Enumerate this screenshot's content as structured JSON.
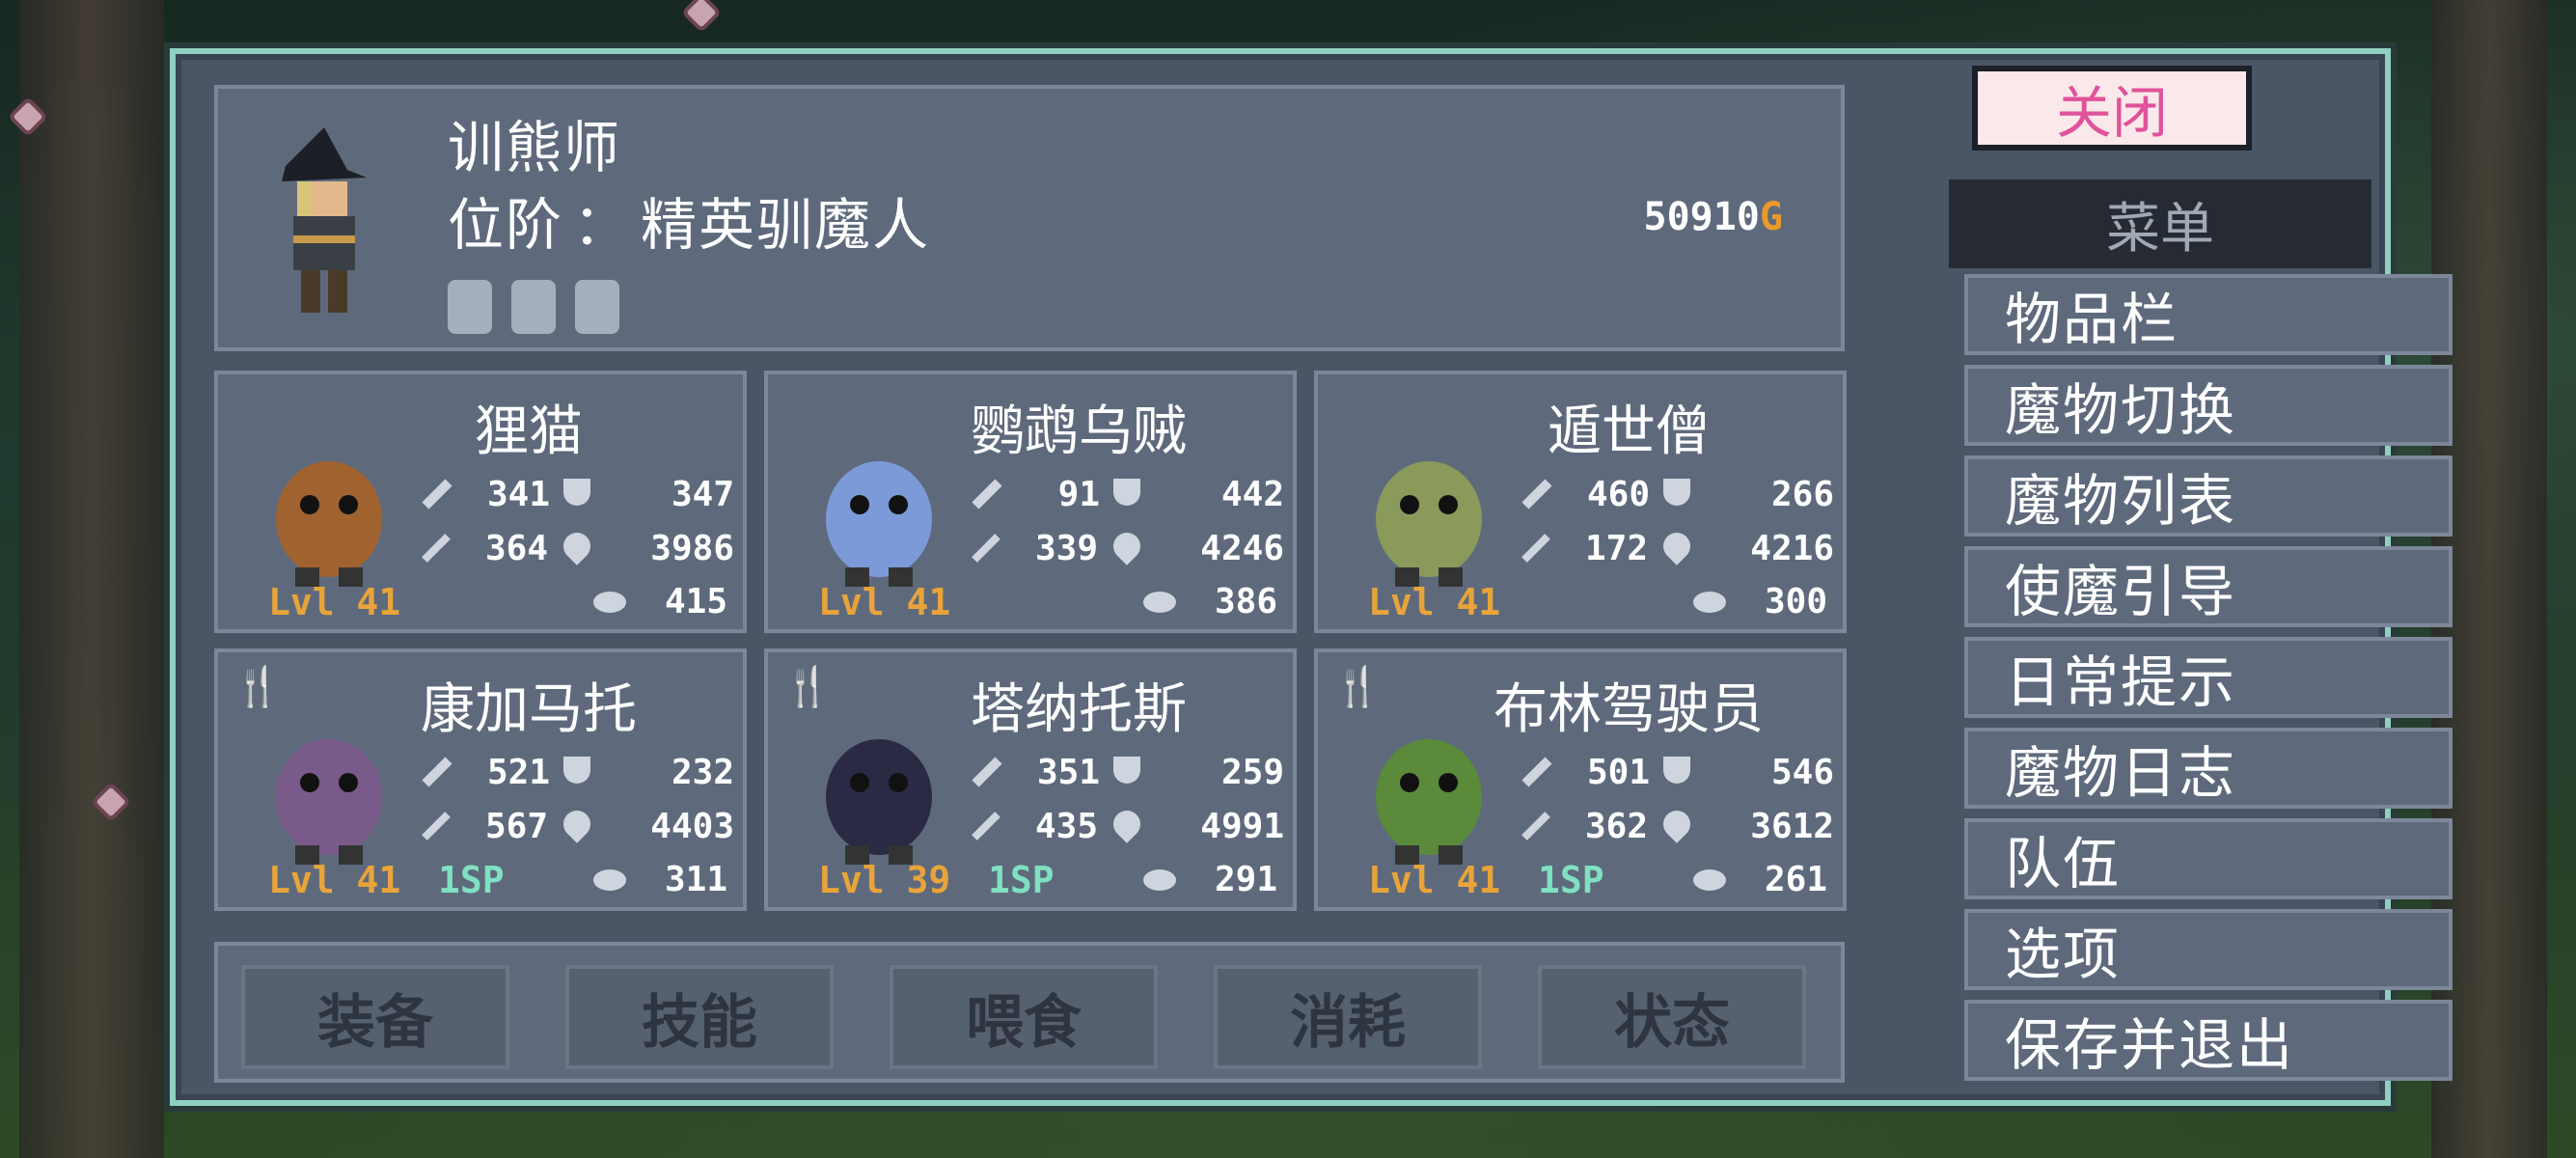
{
  "colors": {
    "frame": "#8fd0c0",
    "panel": "#5e6a7c",
    "level": "#e8a43a",
    "sp": "#7fe0c2",
    "close_text": "#e0529b",
    "gold_g": "#e89a2c"
  },
  "player": {
    "name": "训熊师",
    "rank_label": "位阶",
    "rank_sep": "：",
    "rank": "精英驯魔人",
    "gold": "50910",
    "gold_unit": "G",
    "equipment_icons": [
      "gloves-icon",
      "armor-icon",
      "ring-icon"
    ]
  },
  "monsters": [
    {
      "name": "狸猫",
      "atk": "341",
      "def": "347",
      "mag": "364",
      "hp": "3986",
      "level": "Lvl 41",
      "sp": "",
      "stone": "415",
      "fed": false
    },
    {
      "name": "鹦鹉乌贼",
      "atk": "91",
      "def": "442",
      "mag": "339",
      "hp": "4246",
      "level": "Lvl 41",
      "sp": "",
      "stone": "386",
      "fed": false
    },
    {
      "name": "遁世僧",
      "atk": "460",
      "def": "266",
      "mag": "172",
      "hp": "4216",
      "level": "Lvl 41",
      "sp": "",
      "stone": "300",
      "fed": false
    },
    {
      "name": "康加马托",
      "atk": "521",
      "def": "232",
      "mag": "567",
      "hp": "4403",
      "level": "Lvl 41",
      "sp": "1SP",
      "stone": "311",
      "fed": true
    },
    {
      "name": "塔纳托斯",
      "atk": "351",
      "def": "259",
      "mag": "435",
      "hp": "4991",
      "level": "Lvl 39",
      "sp": "1SP",
      "stone": "291",
      "fed": true
    },
    {
      "name": "布林驾驶员",
      "atk": "501",
      "def": "546",
      "mag": "362",
      "hp": "3612",
      "level": "Lvl 41",
      "sp": "1SP",
      "stone": "261",
      "fed": true
    }
  ],
  "tabs": [
    "装备",
    "技能",
    "喂食",
    "消耗",
    "状态"
  ],
  "close_label": "关闭",
  "menu": {
    "title": "菜单",
    "items": [
      "物品栏",
      "魔物切换",
      "魔物列表",
      "使魔引导",
      "日常提示",
      "魔物日志",
      "队伍",
      "选项",
      "保存并退出"
    ]
  }
}
